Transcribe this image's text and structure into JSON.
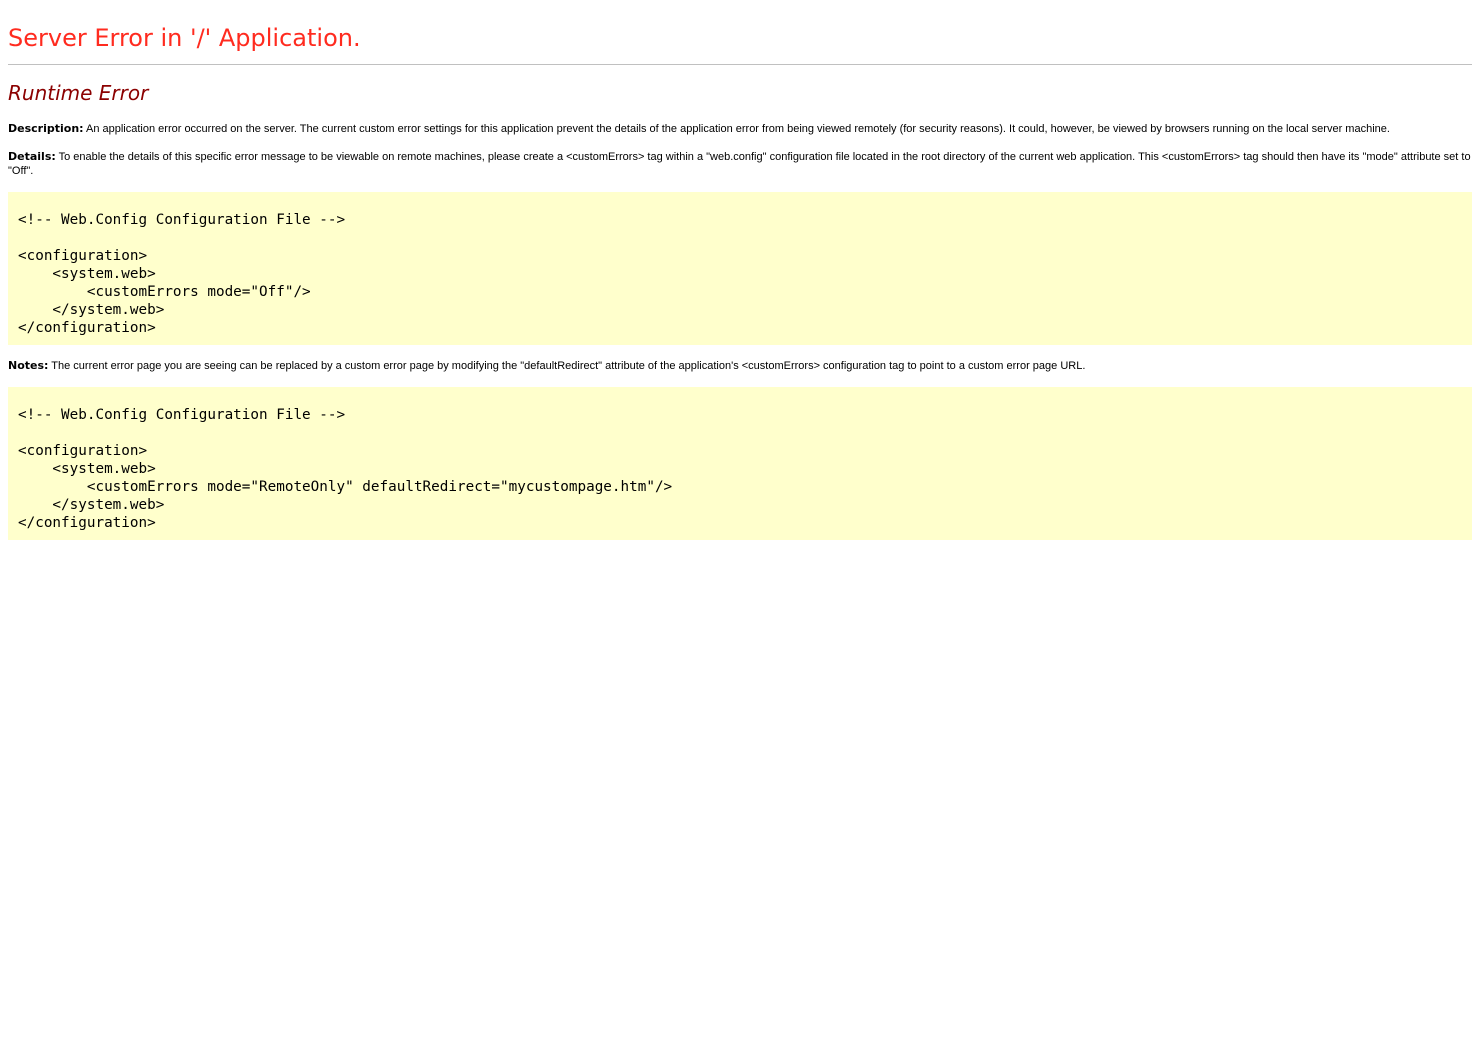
{
  "header": {
    "title": "Server Error in '/' Application.",
    "subtitle": "Runtime Error"
  },
  "description": {
    "label": "Description:",
    "text": " An application error occurred on the server. The current custom error settings for this application prevent the details of the application error from being viewed remotely (for security reasons). It could, however, be viewed by browsers running on the local server machine."
  },
  "details": {
    "label": "Details:",
    "text": " To enable the details of this specific error message to be viewable on remote machines, please create a <customErrors> tag within a \"web.config\" configuration file located in the root directory of the current web application. This <customErrors> tag should then have its \"mode\" attribute set to \"Off\"."
  },
  "code_block_1": {
    "text": "<!-- Web.Config Configuration File -->\n\n<configuration>\n    <system.web>\n        <customErrors mode=\"Off\"/>\n    </system.web>\n</configuration>"
  },
  "notes": {
    "label": "Notes:",
    "text": " The current error page you are seeing can be replaced by a custom error page by modifying the \"defaultRedirect\" attribute of the application's <customErrors> configuration tag to point to a custom error page URL."
  },
  "code_block_2": {
    "text": "<!-- Web.Config Configuration File -->\n\n<configuration>\n    <system.web>\n        <customErrors mode=\"RemoteOnly\" defaultRedirect=\"mycustompage.htm\"/>\n    </system.web>\n</configuration>"
  },
  "colors": {
    "title": "#ff2b1f",
    "subtitle": "#8b0000",
    "code_background": "#ffffcc",
    "rule": "#c0c0c0"
  }
}
